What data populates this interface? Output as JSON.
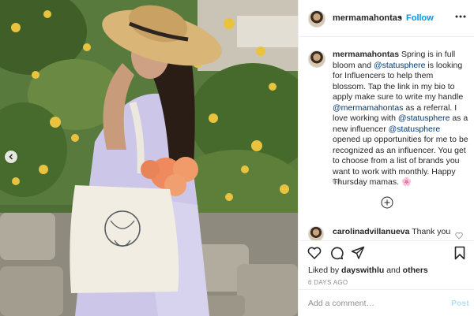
{
  "header": {
    "username": "mermamahontas",
    "separator": "•",
    "follow_label": "Follow",
    "more_icon": "more-options-icon"
  },
  "caption": {
    "username": "mermamahontas",
    "t1": "Spring is in full bloom and",
    "m1": "@statusphere",
    "t2": "is looking for Influencers to help them blossom. Tap the link in my bio to apply make sure to write my handle",
    "m2": "@mermamahontas",
    "t3": "as a referral. I love working with",
    "m3": "@statusphere",
    "t4": "as a new influencer",
    "m4": "@statusphere",
    "t5": "opened up opportunities for me to be recognized as an influencer. You get to choose from a list of brands you want to work with monthly. Happy Thursday mamas.",
    "emoji": "🌸",
    "time": "6d"
  },
  "comment": {
    "username": "carolinadvillanueva",
    "text": "Thank you"
  },
  "actions": {
    "liked_prefix": "Liked by",
    "liked_user": "dayswithlu",
    "liked_and": "and",
    "liked_others": "others",
    "date": "6 DAYS AGO"
  },
  "add_comment": {
    "placeholder": "Add a comment…",
    "post_label": "Post"
  },
  "colors": {
    "link_blue": "#0095f6",
    "mention_blue": "#00376b",
    "post_disabled": "#b2dffc",
    "border": "#efefef"
  }
}
